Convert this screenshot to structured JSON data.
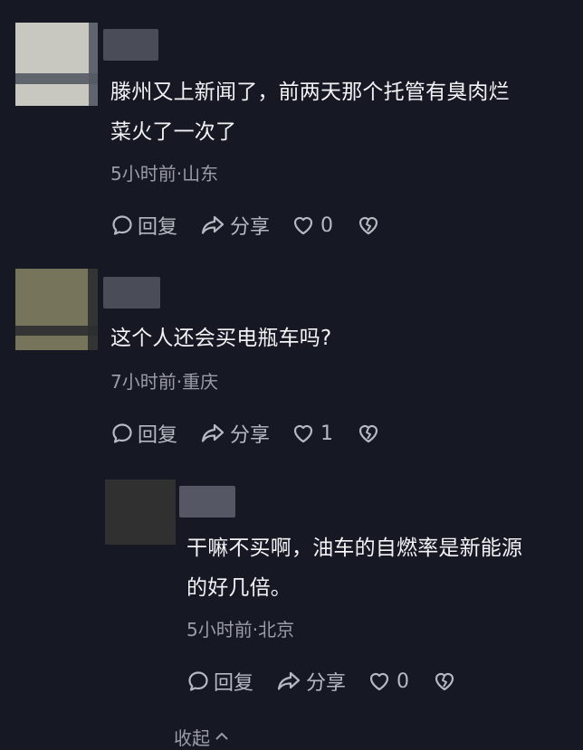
{
  "comments": [
    {
      "text_lines": [
        "滕州又上新闻了，前两天那个托管有臭肉烂",
        "菜火了一次了"
      ],
      "meta": "5小时前·山东",
      "reply_label": "回复",
      "share_label": "分享",
      "like_count": "0",
      "colors": {
        "avatar_bg": "#c8c8c0",
        "avatar_stripe": "#545a64",
        "name_block": "#4a4d58"
      }
    },
    {
      "text_lines": [
        "这个人还会买电瓶车吗?"
      ],
      "meta": "7小时前·重庆",
      "reply_label": "回复",
      "share_label": "分享",
      "like_count": "1",
      "colors": {
        "avatar_bg": "#77745c",
        "avatar_stripe": "#2c2d30",
        "name_block": "#4a4d58"
      }
    },
    {
      "text_lines": [
        "干嘛不买啊，油车的自燃率是新能源",
        "的好几倍。"
      ],
      "meta": "5小时前·北京",
      "reply_label": "回复",
      "share_label": "分享",
      "like_count": "0",
      "colors": {
        "avatar_bg": "#2f302f",
        "avatar_stripe": "#2f302f",
        "name_block": "#555864"
      }
    }
  ],
  "collapse_label": "收起"
}
